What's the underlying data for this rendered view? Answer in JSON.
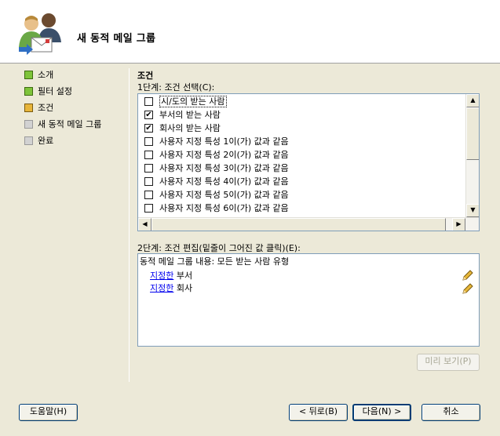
{
  "header": {
    "title": "새 동적 메일 그룹"
  },
  "nav": {
    "items": [
      {
        "label": "소개",
        "state": "done"
      },
      {
        "label": "필터 설정",
        "state": "done"
      },
      {
        "label": "조건",
        "state": "current"
      },
      {
        "label": "새 동적 메일 그룹",
        "state": "pending"
      },
      {
        "label": "완료",
        "state": "pending"
      }
    ]
  },
  "main": {
    "section_title": "조건",
    "step1_label": "1단계: 조건 선택(C):",
    "conditions": [
      {
        "label": "시/도의 받는 사람",
        "checked": false
      },
      {
        "label": "부서의 받는 사람",
        "checked": true
      },
      {
        "label": "회사의 받는 사람",
        "checked": true
      },
      {
        "label": "사용자 지정 특성 1이(가) 값과 같음",
        "checked": false
      },
      {
        "label": "사용자 지정 특성 2이(가) 값과 같음",
        "checked": false
      },
      {
        "label": "사용자 지정 특성 3이(가) 값과 같음",
        "checked": false
      },
      {
        "label": "사용자 지정 특성 4이(가) 값과 같음",
        "checked": false
      },
      {
        "label": "사용자 지정 특성 5이(가) 값과 같음",
        "checked": false
      },
      {
        "label": "사용자 지정 특성 6이(가) 값과 같음",
        "checked": false
      }
    ],
    "step2_label": "2단계: 조건 편집(밑줄이 그어진 값 클릭)(E):",
    "description": {
      "heading": "동적 메일 그룹 내용: 모든 받는 사람 유형",
      "lines": [
        {
          "link": "지정한",
          "text": " 부서"
        },
        {
          "link": "지정한",
          "text": " 회사"
        }
      ]
    },
    "preview_label": "미리 보기(P)"
  },
  "footer": {
    "help_label": "도움말(H)",
    "back_label": "< 뒤로(B)",
    "next_label": "다음(N) >",
    "cancel_label": "취소"
  },
  "colors": {
    "dialog_bg": "#ece9d8",
    "step_done": "#7ec43a",
    "step_current": "#e7b53a",
    "step_pending": "#d2d2d2",
    "link": "#0000ee"
  },
  "icons": {
    "header": "users-mail-icon",
    "edit": "pencil-icon"
  }
}
